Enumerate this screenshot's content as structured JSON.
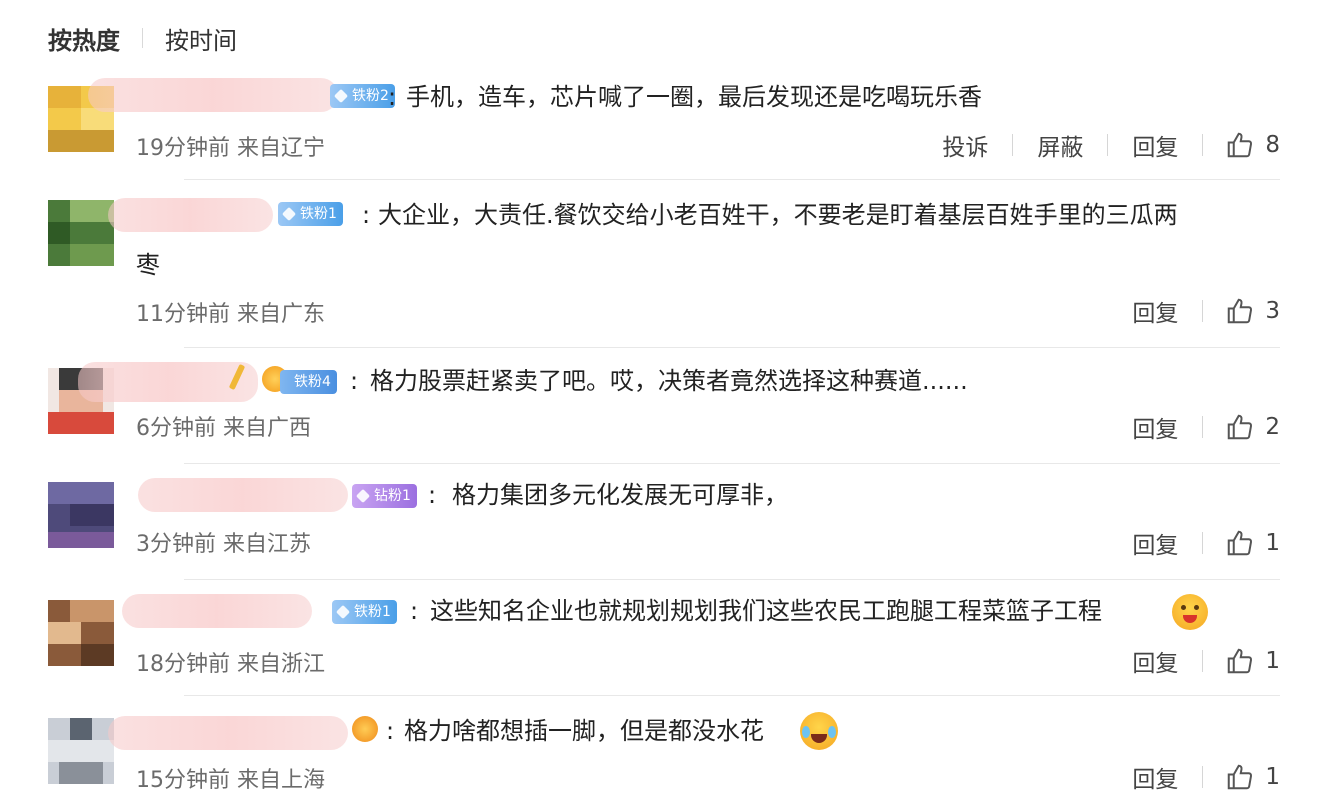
{
  "sort": {
    "hot": "按热度",
    "time": "按时间"
  },
  "actions": {
    "report": "投诉",
    "block": "屏蔽",
    "reply": "回复"
  },
  "comments": [
    {
      "badge": "铁粉2",
      "text": "手机，造车，芯片喊了一圈，最后发现还是吃喝玩乐香",
      "meta": "19分钟前 来自辽宁",
      "likes": "8"
    },
    {
      "badge": "铁粉1",
      "text": "大企业，大责任.餐饮交给小老百姓干，不要老是盯着基层百姓手里的三瓜两",
      "text2": "枣",
      "meta": "11分钟前 来自广东",
      "likes": "3"
    },
    {
      "badge": "铁粉4",
      "text": "格力股票赶紧卖了吧。哎，决策者竟然选择这种赛道......",
      "meta": "6分钟前 来自广西",
      "likes": "2"
    },
    {
      "badge": "钻粉1",
      "text": "格力集团多元化发展无可厚非，",
      "meta": "3分钟前 来自江苏",
      "likes": "1"
    },
    {
      "badge": "铁粉1",
      "text": "这些知名企业也就规划规划我们这些农民工跑腿工程菜篮子工程",
      "meta": "18分钟前 来自浙江",
      "likes": "1"
    },
    {
      "text": "格力啥都想插一脚，但是都没水花",
      "meta": "15分钟前 来自上海",
      "likes": "1"
    }
  ],
  "colors": {
    "badge_blue": "#4a9fe8",
    "badge_purple": "#9b6fe0",
    "divider": "#e8e8e8"
  },
  "icons": [
    "thumbs-up-icon",
    "diamond-icon",
    "crown-icon",
    "grinning-face-emoji",
    "laughing-crying-emoji"
  ]
}
